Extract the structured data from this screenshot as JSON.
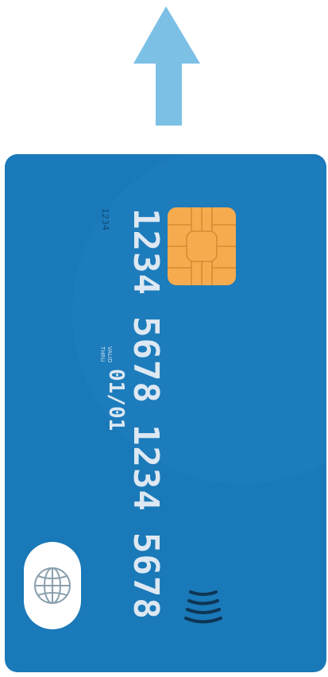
{
  "card": {
    "number_groups": [
      "1234",
      "5678",
      "1234",
      "5678"
    ],
    "small_number": "1234",
    "valid_line1": "VALID",
    "valid_line2": "THRU",
    "expiry": "01/01"
  },
  "icons": {
    "arrow": "up-arrow-icon",
    "chip": "chip-icon",
    "globe": "globe-icon",
    "contactless": "contactless-icon"
  },
  "colors": {
    "arrow": "#7cc0e6",
    "card": "#1a79b8",
    "chip": "#f7ab4f",
    "text": "#dde8f2"
  }
}
